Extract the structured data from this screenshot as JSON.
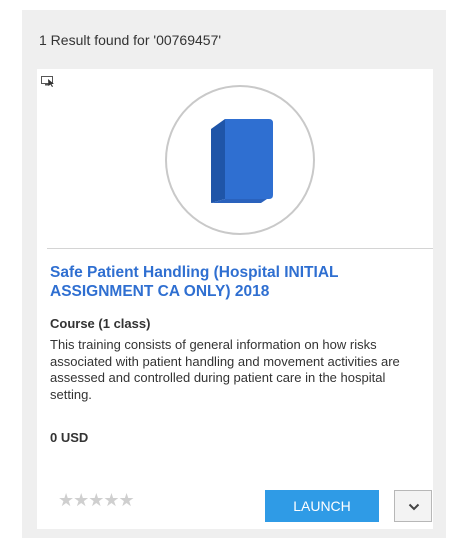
{
  "results": {
    "summary": "1 Result found for '00769457'"
  },
  "card": {
    "device_icon": "desktop-cursor-icon",
    "thumbnail_icon": "book-icon",
    "title": "Safe Patient Handling (Hospital INITIAL ASSIGNMENT CA ONLY) 2018",
    "type": "Course (1 class)",
    "description": "This training consists of general information on how risks associated with patient handling and movement activities are assessed and controlled during patient care in the hospital setting.",
    "price": "0 USD",
    "rating": {
      "stars": "★★★★★",
      "value": 0,
      "max": 5
    },
    "launch_label": "LAUNCH",
    "more_icon": "chevron-down-icon"
  },
  "colors": {
    "title_link": "#2f6fd1",
    "launch_button": "#2f9be6",
    "book_fill": "#2f6fd1",
    "panel_bg": "#efefef"
  }
}
